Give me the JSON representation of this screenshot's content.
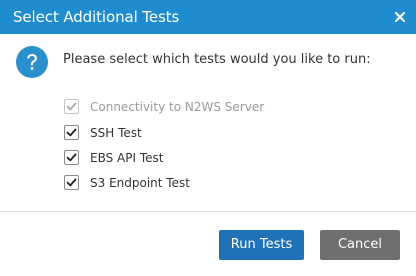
{
  "dialog": {
    "title": "Select Additional Tests",
    "close_label": "×",
    "prompt": "Please select which tests would you like to run:",
    "icons": {
      "info": "question-icon",
      "close": "close-icon",
      "check": "checkmark-icon"
    },
    "colors": {
      "titlebar": "#1e8ccf",
      "primary_button": "#1f72b8",
      "secondary_button": "#6f6f6f",
      "question_icon": "#2a8fcd"
    }
  },
  "tests": [
    {
      "label": "Connectivity to N2WS Server",
      "checked": true,
      "disabled": true
    },
    {
      "label": "SSH Test",
      "checked": true,
      "disabled": false
    },
    {
      "label": "EBS API Test",
      "checked": true,
      "disabled": false
    },
    {
      "label": "S3 Endpoint Test",
      "checked": true,
      "disabled": false
    }
  ],
  "buttons": {
    "run": "Run Tests",
    "cancel": "Cancel"
  }
}
